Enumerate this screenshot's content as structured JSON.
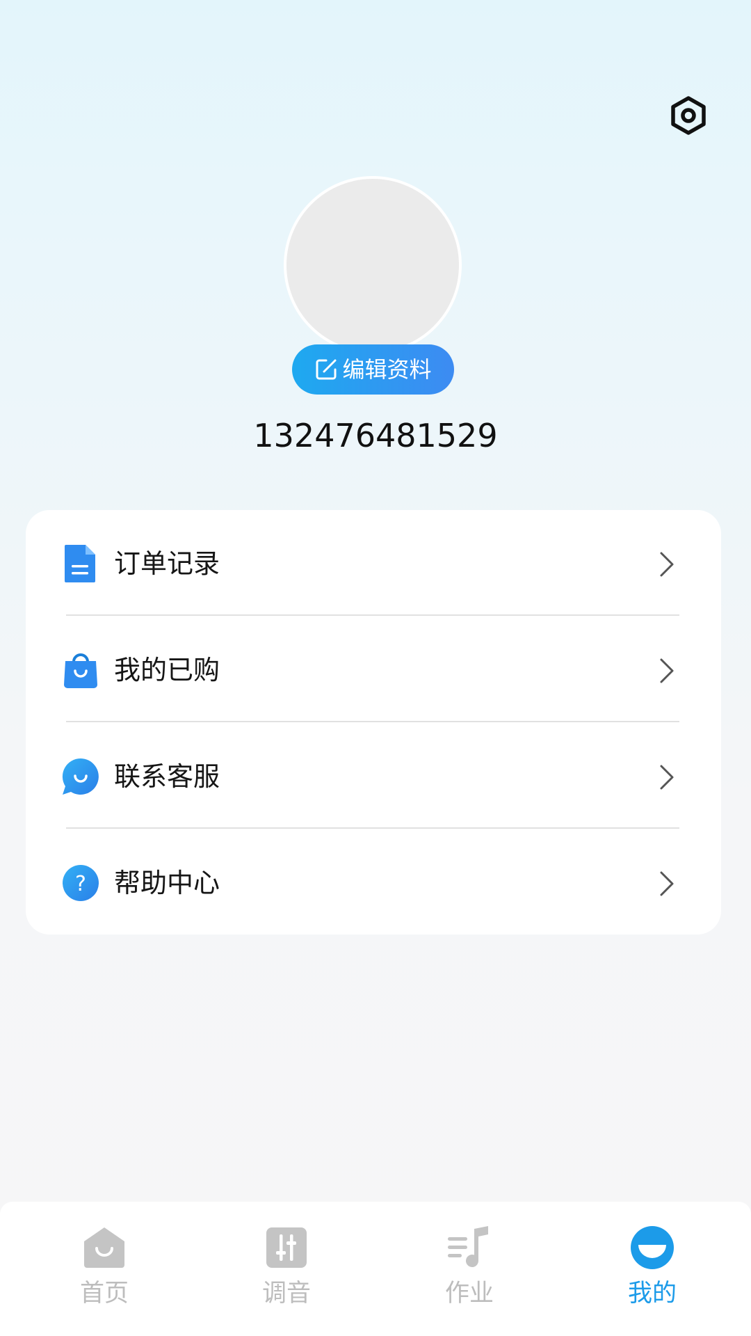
{
  "header": {
    "settings_icon": "gear-hexagon-icon"
  },
  "profile": {
    "avatar": "avatar-placeholder",
    "edit_label": "编辑资料",
    "edit_icon": "edit-square-icon",
    "phone": "132476481529"
  },
  "menu": {
    "items": [
      {
        "label": "订单记录",
        "icon": "document-icon"
      },
      {
        "label": "我的已购",
        "icon": "shopping-bag-icon"
      },
      {
        "label": "联系客服",
        "icon": "chat-bubble-icon"
      },
      {
        "label": "帮助中心",
        "icon": "help-question-icon"
      }
    ]
  },
  "tabbar": {
    "tabs": [
      {
        "label": "首页",
        "icon": "home-icon",
        "active": false
      },
      {
        "label": "调音",
        "icon": "tuner-sliders-icon",
        "active": false
      },
      {
        "label": "作业",
        "icon": "music-note-list-icon",
        "active": false
      },
      {
        "label": "我的",
        "icon": "profile-smile-icon",
        "active": true
      }
    ]
  },
  "colors": {
    "accent": "#1c9be9",
    "inactive_tab": "#bdbdbd",
    "menu_icon_blue": "#2f8cf0",
    "edit_gradient_start": "#1ea9f0",
    "edit_gradient_end": "#3d8bf2"
  }
}
